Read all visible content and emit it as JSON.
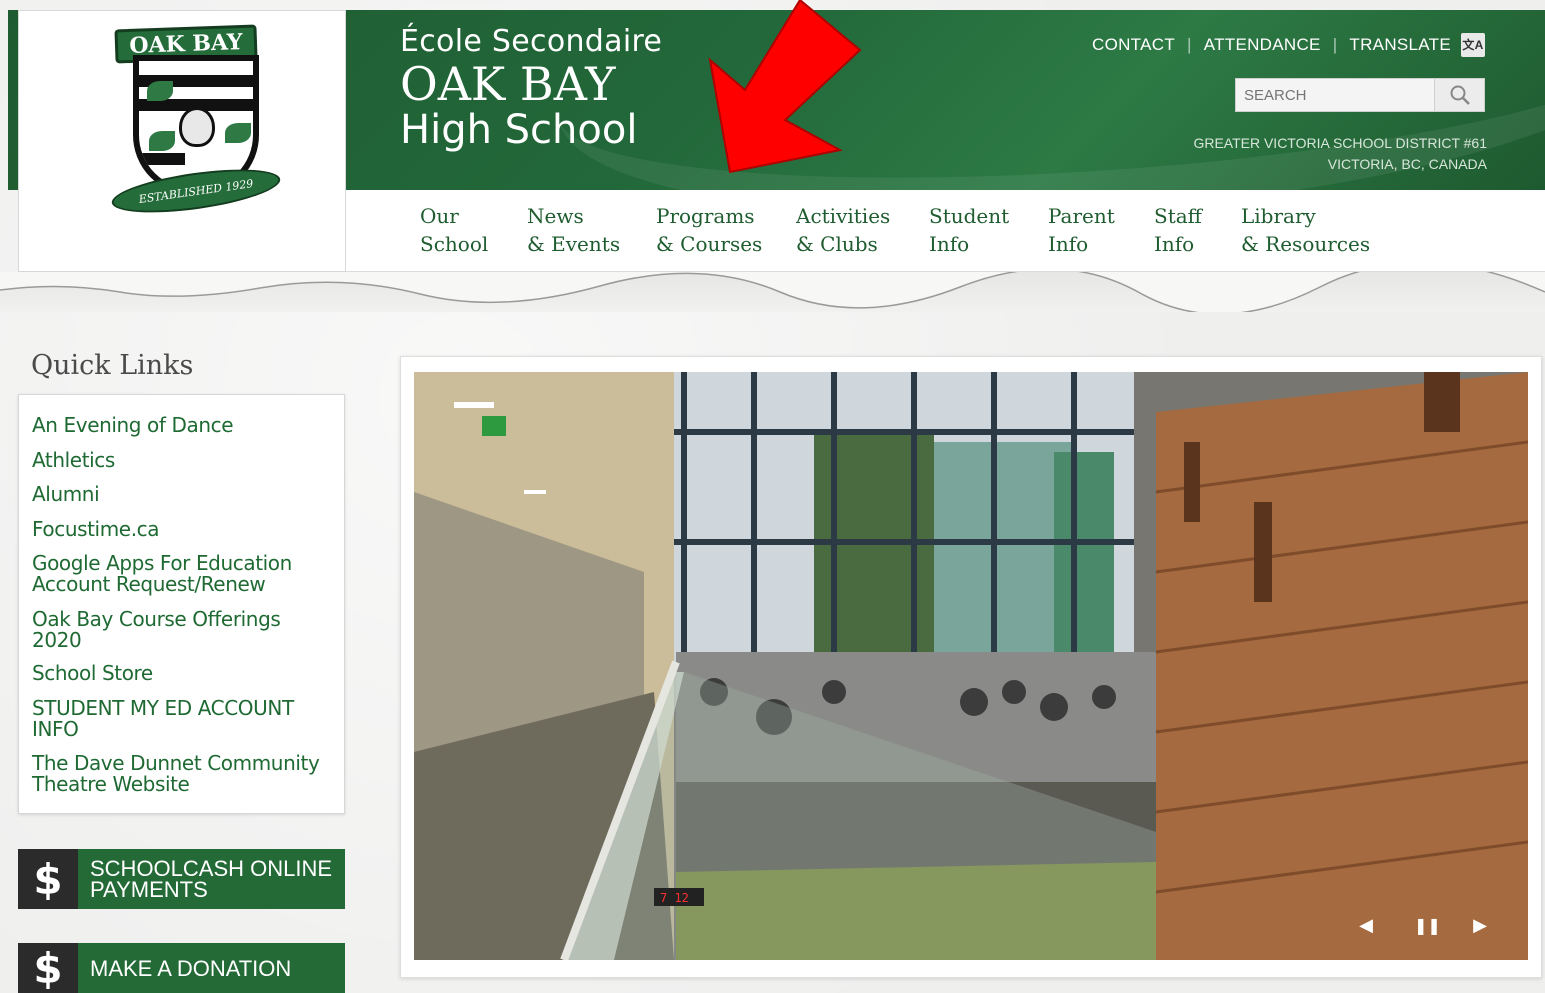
{
  "header": {
    "school_name_line1": "École Secondaire",
    "school_name_line2": "OAK BAY",
    "school_name_line3": "High School",
    "utility_links": [
      "CONTACT",
      "ATTENDANCE",
      "TRANSLATE"
    ],
    "search_placeholder": "SEARCH",
    "district_line1": "GREATER VICTORIA SCHOOL DISTRICT #61",
    "district_line2": "VICTORIA, BC, CANADA",
    "logo_banner_text": "OAK BAY",
    "logo_ribbon_text": "ESTABLISHED 1929"
  },
  "nav": {
    "items": [
      {
        "line1": "Our",
        "line2": "School"
      },
      {
        "line1": "News",
        "line2": "& Events"
      },
      {
        "line1": "Programs",
        "line2": "& Courses"
      },
      {
        "line1": "Activities",
        "line2": "& Clubs"
      },
      {
        "line1": "Student",
        "line2": "Info"
      },
      {
        "line1": "Parent",
        "line2": "Info"
      },
      {
        "line1": "Staff",
        "line2": "Info"
      },
      {
        "line1": "Library",
        "line2": "& Resources"
      }
    ]
  },
  "sidebar": {
    "title": "Quick Links",
    "links": [
      "An Evening of Dance",
      "Athletics",
      "Alumni",
      "Focustime.ca",
      "Google Apps For Education Account Request/Renew",
      "Oak Bay Course Offerings 2020",
      "School Store",
      "STUDENT MY ED ACCOUNT INFO",
      "The Dave Dunnet Community Theatre Website"
    ],
    "buttons": [
      {
        "icon": "$",
        "label_line1": "SCHOOLCASH ONLINE",
        "label_line2": "PAYMENTS"
      },
      {
        "icon": "$",
        "label_line1": "MAKE A DONATION",
        "label_line2": ""
      }
    ]
  },
  "slideshow": {
    "controls": {
      "prev": "◀",
      "pause": "❚❚",
      "next": "▶"
    },
    "clock_text": "7 12"
  },
  "colors": {
    "brand_green": "#1f5b30",
    "link_green": "#1f6a33",
    "annotation_red": "#ff0000"
  }
}
